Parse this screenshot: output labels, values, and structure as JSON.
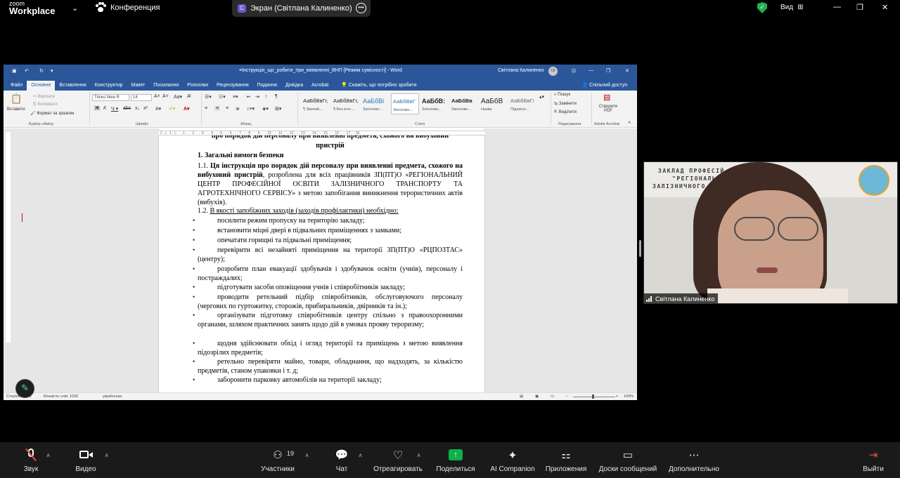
{
  "app": {
    "logo_top": "zoom",
    "logo_bottom": "Workplace",
    "meeting_label": "Конференция",
    "share_pill_avatar": "С",
    "share_pill_text": "Экран (Світлана Калиненко)",
    "view_label": "Вид"
  },
  "word": {
    "title": "≡Інструкція_що_робити_при_виявленні_ВНП [Режим сумісності] - Word",
    "user": "Світлана Калиненко",
    "user_initials": "СК",
    "tabs": [
      "Файл",
      "Основне",
      "Вставлення",
      "Конструктор",
      "Макет",
      "Посилання",
      "Розсилки",
      "Рецензування",
      "Подання",
      "Довідка",
      "Acrobat"
    ],
    "tell_me": "Скажіть, що потрібно зробити",
    "share": "Спільний доступ",
    "clipboard": {
      "paste": "Вставити",
      "cut": "Вирізати",
      "copy": "Копіювати",
      "format_painter": "Формат за зразком",
      "label": "Буфер обміну"
    },
    "font": {
      "name": "Times New R",
      "size": "14",
      "label": "Шрифт"
    },
    "paragraph_label": "Абзац",
    "styles": [
      {
        "preview": "АаБбВвГг,",
        "name": "¶ Звичай..."
      },
      {
        "preview": "АаБбВвГг,",
        "name": "¶ Без інте..."
      },
      {
        "preview": "АаБбВі",
        "name": "Заголово..."
      },
      {
        "preview": "АаБбВвГ",
        "name": "Заголово..."
      },
      {
        "preview": "АаБбВ:",
        "name": "Заголово..."
      },
      {
        "preview": "АаБбВв",
        "name": "Заголово..."
      },
      {
        "preview": "АаБбВ",
        "name": "Назва"
      },
      {
        "preview": "АаБбВвГі",
        "name": "Підзагол..."
      }
    ],
    "styles_label": "Стилі",
    "editing": {
      "find": "Пошук",
      "replace": "Замінити",
      "select": "Виділити",
      "label": "Редагування"
    },
    "acrobat": {
      "create": "Створити PDF",
      "label": "Adobe Acrobat"
    },
    "ruler": "· 2 · | · 1 · | · · · 1 · · · 2 · · · 3 · · · 4 · · · 5 · · · 6 · · · 7 · · · 8 · · · 9 · · · 10 · · · 11 · · · 12 · · · 13 · · · 14 · · · 15 · · · 16 · · · 17 · ·  18",
    "status": {
      "page": "Сторінка 1 з 5",
      "words": "Кількість слів: 1026",
      "language": "українська",
      "zoom": "100%"
    }
  },
  "doc": {
    "heading_line1": "про порядок дій персоналу при виявленні предмета, схожого на вибуховий",
    "heading_line2": "пристрій",
    "section1": "1. Загальні вимоги безпеки",
    "p11_num": "1.1. ",
    "p11_bold": "Ця інструкція про порядок дій персоналу при виявленні предмета, схожого на вибуховий пристрій",
    "p11_rest": ", розроблена для всіх працівників ЗП(ПТ)О «РЕГІОНАЛЬНИЙ ЦЕНТР ПРОФЕСІЙНОЇ ОСВІТИ ЗАЛІЗНИЧНОГО ТРАНСПОРТУ ТА АГРОТЕХНІЧНОГО СЕРВІСУ» з метою запобігання виникнення терористичних актів (вибухів).",
    "p12_num": "1.2. ",
    "p12_text": "В якості запобіжних заходів (заходів профілактики) необхідно:",
    "bullets": [
      "посилити режим пропуску на територію закладу;",
      "встановити міцні двері в підвальних приміщеннях з замками;",
      "опечатати горищні та підвальні приміщення;",
      "перевірити всі незайняті приміщення на території ЗП(ПТ)О «РЦПОЗТАС» (центру);",
      "розробити план евакуації здобувачів і здобувачок освіти (учнів), персоналу і постраждалих;",
      "підготувати засоби оповіщення учнів і співробітників закладу;",
      "проводити ретельний підбір співробітників, обслуговуючого персоналу (чергових по гуртожитку, сторожів, прибиральників, двірників та ін.);",
      "організувати підготовку співробітників центру спільно з правоохоронними органами, шляхом практичних занять щодо дій в умовах прояву тероризму;",
      "щодня здійснювати обхід і огляд території та приміщень з метою виявлення підозрілих предметів;",
      "ретельно перевіряти майно, товари, обладнання, що надходять, за кількістю предметів, станом упаковки і т. д;",
      "заборонити парковку автомобілів на території закладу;"
    ]
  },
  "video": {
    "banner_line1": "ЗАКЛАД ПРОФЕСІЙ      ЧНОЇ)ОСВІТИ",
    "banner_line2": "\"РЕГІОНАЛЬ             ОСВІТИ",
    "banner_line3": "ЗАЛІЗНИЧНОГО Т               ГО СЕРВІСУ\"",
    "participant": "Світлана Калиненко"
  },
  "toolbar": {
    "audio": "Звук",
    "video": "Видео",
    "participants": "Участники",
    "participants_count": "19",
    "chat": "Чат",
    "react": "Отреагировать",
    "share": "Поделиться",
    "ai": "AI Companion",
    "apps": "Приложения",
    "boards": "Доски сообщений",
    "more": "Дополнительно",
    "leave": "Выйти"
  },
  "colors": {
    "word_blue": "#2b579a",
    "share_green": "#0db04b",
    "leave_red": "#e74c3c"
  }
}
